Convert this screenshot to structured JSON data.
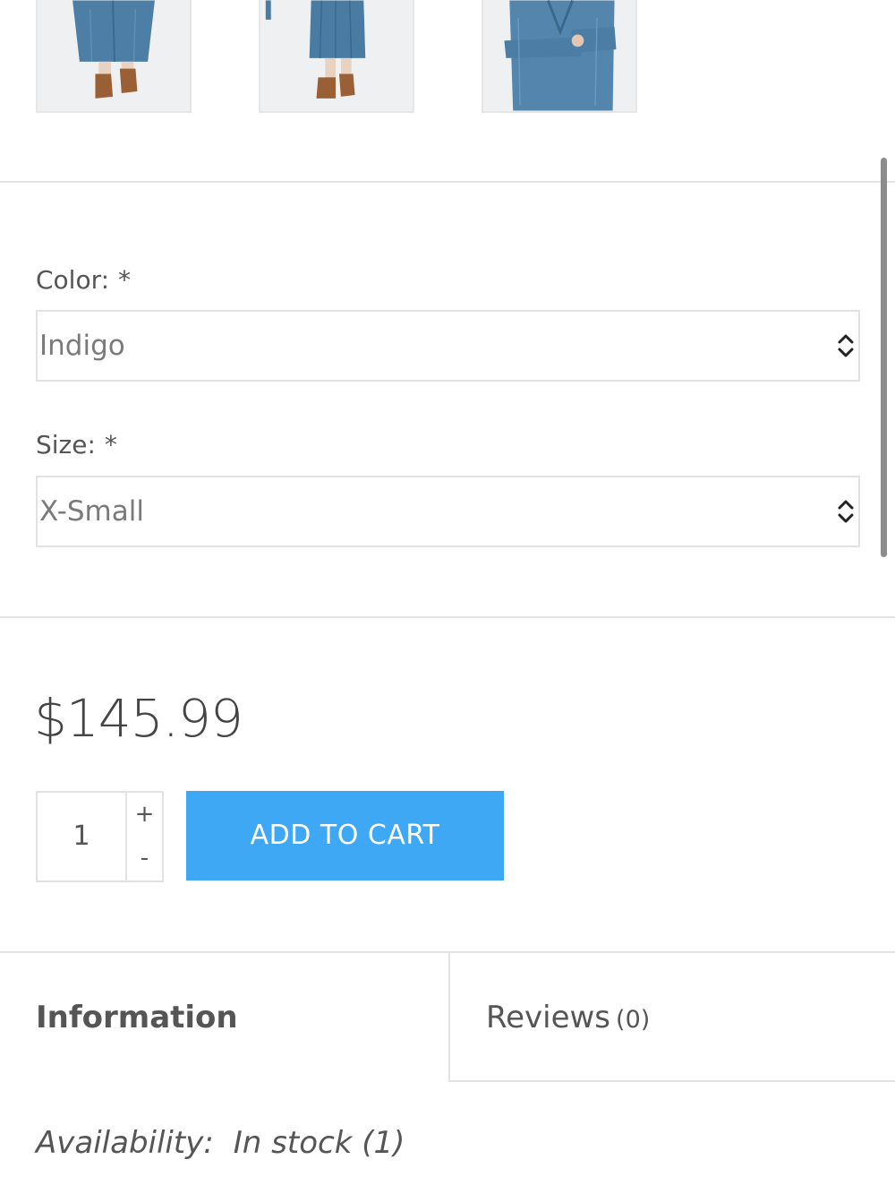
{
  "gallery": {
    "thumbnails": [
      {
        "name": "denim dress full length front"
      },
      {
        "name": "denim dress full length angle"
      },
      {
        "name": "denim dress upper body detail"
      }
    ]
  },
  "options": {
    "color": {
      "label": "Color:",
      "required_mark": "*",
      "selected": "Indigo"
    },
    "size": {
      "label": "Size:",
      "required_mark": "*",
      "selected": "X-Small"
    }
  },
  "product": {
    "price": "$145.99",
    "quantity": "1",
    "qty_plus": "+",
    "qty_minus": "-",
    "add_to_cart": "ADD TO CART",
    "accent_color": "#3ea8f5"
  },
  "tabs": {
    "information": "Information",
    "reviews": "Reviews",
    "reviews_count": "(0)"
  },
  "availability": {
    "label": "Availability:",
    "value": "In stock (1)"
  }
}
